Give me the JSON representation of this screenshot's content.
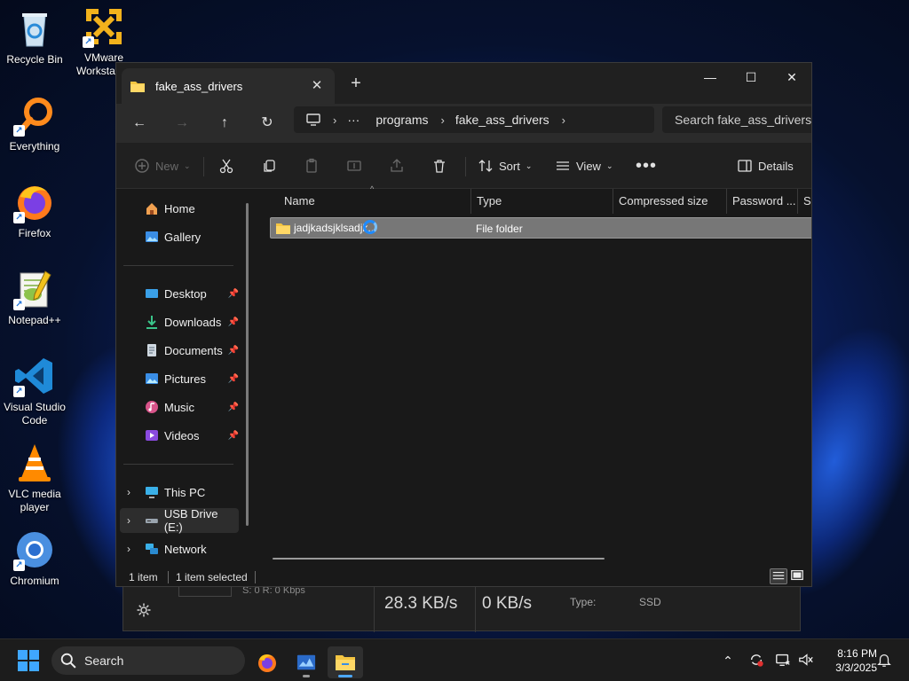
{
  "desktop": {
    "icons": [
      {
        "label": "Recycle Bin",
        "icon": "recycle-bin-icon"
      },
      {
        "label": "VMware Workstation",
        "icon": "vmware-icon"
      },
      {
        "label": "Everything",
        "icon": "everything-icon"
      },
      {
        "label": "Firefox",
        "icon": "firefox-icon"
      },
      {
        "label": "Notepad++",
        "icon": "notepad-plus-plus-icon"
      },
      {
        "label": "Visual Studio Code",
        "icon": "vscode-icon"
      },
      {
        "label": "VLC media player",
        "icon": "vlc-icon"
      },
      {
        "label": "Chromium",
        "icon": "chromium-icon"
      }
    ]
  },
  "background_window": {
    "small_text": "S: 0 R: 0 Kbps",
    "speed_1": "28.3 KB/s",
    "speed_2": "0 KB/s",
    "type_label": "Type:",
    "type_value": "SSD"
  },
  "explorer": {
    "tab_title": "fake_ass_drivers",
    "address": {
      "ellipsis": "···",
      "segments": [
        "programs",
        "fake_ass_drivers"
      ]
    },
    "search_placeholder": "Search fake_ass_drivers",
    "commands": {
      "new": "New",
      "sort": "Sort",
      "view": "View",
      "details": "Details"
    },
    "sidebar": {
      "home": "Home",
      "gallery": "Gallery",
      "desktop": "Desktop",
      "downloads": "Downloads",
      "documents": "Documents",
      "pictures": "Pictures",
      "music": "Music",
      "videos": "Videos",
      "this_pc": "This PC",
      "usb_drive": "USB Drive (E:)",
      "network": "Network"
    },
    "columns": {
      "name": "Name",
      "type": "Type",
      "compressed": "Compressed size",
      "password": "Password ...",
      "size": "Si"
    },
    "rows": [
      {
        "name": "jadjkadsjklsadjk...",
        "type": "File folder"
      }
    ],
    "status": {
      "count": "1 item",
      "selected": "1 item selected"
    }
  },
  "taskbar": {
    "search": "Search",
    "time": "8:16 PM",
    "date": "3/3/2025"
  },
  "colors": {
    "accent": "#1f8bff",
    "folder": "#f4c542",
    "window_bg": "#191919",
    "taskbar_bg": "#1c1c1c"
  }
}
